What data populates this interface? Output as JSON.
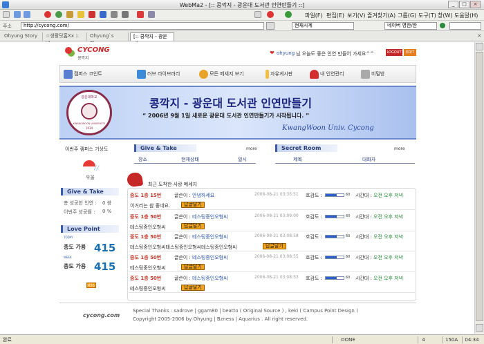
{
  "window": {
    "title": "WebMa2 - [:: 콩깍지 - 광운대 도서관 인연만들기 ::]",
    "controls": [
      "_",
      "□",
      "×"
    ]
  },
  "menu": [
    "파일(F)",
    "편집(E)",
    "보기(V)",
    "즐겨찾기(A)",
    "그룹(G)",
    "도구(T)",
    "창(W)",
    "도움말(H)"
  ],
  "address": {
    "label": "주소",
    "url": "http://cycong.com/",
    "zone": "현재시계",
    "search": "네이버 영한/한"
  },
  "tabs": [
    "Ohyung Story",
    "☆생활닷홈Xx :: 네",
    "Ohyung`s Blog ::",
    "[:: 콩깍지 - 광운대"
  ],
  "site": {
    "logo_main": "CYCONG",
    "logo_sub": "콩깍지",
    "welcome_user": "ohyung",
    "welcome_text": "님 오늘도 좋은 인연 만들어 가세요^^",
    "logout": "LOGOUT",
    "edit": "EDIT",
    "nav": [
      "캠퍼스 코인트",
      "러브 라이브러리",
      "모든 메세지 보기",
      "자유게시판",
      "내 인연관리",
      "비밀방"
    ],
    "banner": {
      "title": "콩깍지 - 광운대 도서관 인연만들기",
      "subtitle": "“ 2006년 9월 1일 새로운 광운대 도서관 인연만들기가 시작됩니다. ”",
      "signature": "KwangWoon Univ. Cycong",
      "seal": "KWANGWOON UNIVERSITY",
      "seal_year": "1934",
      "seal_korean": "광운대학교"
    },
    "weather": {
      "heading": "이번주 캠퍼스 기상도",
      "state": "우울"
    },
    "gt_left": {
      "heading": "Give & Take",
      "success_label": "총 성공한 인연 :",
      "success_value": "0 쌍",
      "rate_label": "이번주 성공률 :",
      "rate_value": "0 %"
    },
    "love_point": {
      "heading": "Love Point",
      "today_tag": "TODAY",
      "today_label": "총도 가용",
      "today_value": "415",
      "week_tag": "WEEK",
      "week_label": "총도 가용",
      "week_value": "415",
      "rss": "RSS"
    },
    "give_take": {
      "heading": "Give & Take",
      "more": "more",
      "cols": [
        "장소",
        "현재상태",
        "일시"
      ]
    },
    "secret": {
      "heading": "Secret Room",
      "more": "more",
      "cols": [
        "제목",
        "대화자"
      ]
    },
    "recent_heading": "최근 도착한 사랑 메세지",
    "messages": [
      {
        "place": "중도 1층 15번",
        "writer_label": "글쓴이 :",
        "writer": "안녕하세요",
        "date": "2006-08-21 03:35:51",
        "fav_label": "호감도 :",
        "fav": 60,
        "time_label": "시간대 :",
        "time": "오전 오후 저녁",
        "body": "이거리는 참 좋네요.",
        "reply": "답글달기"
      },
      {
        "place": "중도 1층 50번",
        "writer_label": "글쓴이 :",
        "writer": "테스팅중인오형씨",
        "date": "2006-08-21 03:09:00",
        "fav_label": "호감도 :",
        "fav": 60,
        "time_label": "시간대 :",
        "time": "오전 오후 저녁",
        "body": "테스팅중인오형씨",
        "reply": "답글달기"
      },
      {
        "place": "중도 1층 50번",
        "writer_label": "글쓴이 :",
        "writer": "테스팅중인오형씨",
        "date": "2006-08-21 03:08:58",
        "fav_label": "호감도 :",
        "fav": 60,
        "time_label": "시간대 :",
        "time": "오전 오후 저녁",
        "body": "테스팅중인오형씨테스팅중인오형씨테스팅중인오형씨",
        "reply": "답글달기"
      },
      {
        "place": "중도 1층 50번",
        "writer_label": "글쓴이 :",
        "writer": "테스팅중인오형씨",
        "date": "2006-08-21 03:08:55",
        "fav_label": "호감도 :",
        "fav": 60,
        "time_label": "시간대 :",
        "time": "오전 오후 저녁",
        "body": "테스팅중인오형씨",
        "reply": "답글달기"
      },
      {
        "place": "중도 1층 50번",
        "writer_label": "글쓴이 :",
        "writer": "테스팅중인오형씨",
        "date": "2006-08-21 03:08:53",
        "fav_label": "호감도 :",
        "fav": 60,
        "time_label": "시간대 :",
        "time": "오전 오후 저녁",
        "body": "테스팅중인오형씨",
        "reply": "답글달기"
      }
    ],
    "footer": {
      "logo": "cycong.com",
      "thanks": "Special Thanks : sadrove | ggam80 | beatto ( Original Source ) , keki ( Campus Point Design )",
      "copyright": "Copyright 2005-2006 by Ohyung | Bzness | Aquarius . All right reserved."
    }
  },
  "status": {
    "left": "완료",
    "done": "DONE",
    "num": "4",
    "mem": "150A",
    "clock": "04:34"
  },
  "colors": {
    "accent": "#2a55a8",
    "button": "#f4a21a",
    "place": "#c0392b"
  }
}
